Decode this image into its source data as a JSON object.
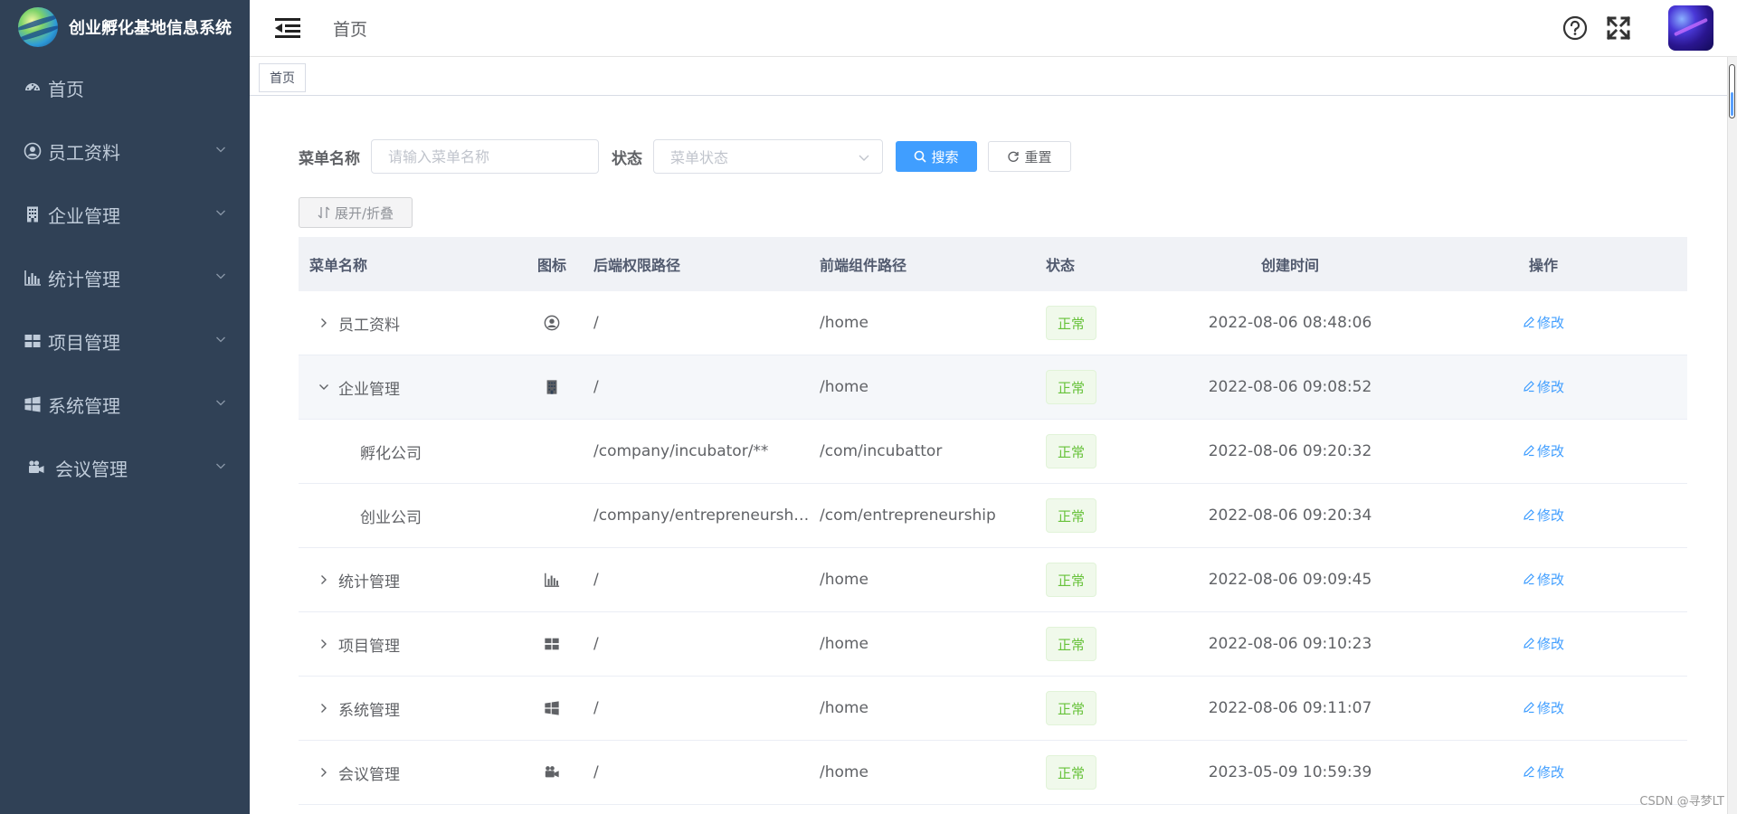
{
  "app": {
    "title": "创业孵化基地信息系统"
  },
  "sidebar": {
    "items": [
      {
        "label": "首页",
        "icon": "dashboard-icon",
        "expandable": false
      },
      {
        "label": "员工资料",
        "icon": "user-circle-icon",
        "expandable": true
      },
      {
        "label": "企业管理",
        "icon": "building-icon",
        "expandable": true
      },
      {
        "label": "统计管理",
        "icon": "bar-chart-icon",
        "expandable": true
      },
      {
        "label": "项目管理",
        "icon": "grid-icon",
        "expandable": true
      },
      {
        "label": "系统管理",
        "icon": "windows-icon",
        "expandable": true
      },
      {
        "label": "会议管理",
        "icon": "camera-icon",
        "expandable": true
      }
    ]
  },
  "header": {
    "breadcrumb": "首页"
  },
  "tags": {
    "active": "首页"
  },
  "search": {
    "menu_name_label": "菜单名称",
    "menu_name_placeholder": "请输入菜单名称",
    "status_label": "状态",
    "status_placeholder": "菜单状态",
    "search_button": "搜索",
    "reset_button": "重置",
    "toggle_button": "展开/折叠"
  },
  "table": {
    "headers": {
      "name": "菜单名称",
      "icon": "图标",
      "perm": "后端权限路径",
      "component": "前端组件路径",
      "status": "状态",
      "created": "创建时间",
      "ops": "操作"
    },
    "rows": [
      {
        "name": "员工资料",
        "icon": "user-circle-icon",
        "perm": "/",
        "component": "/home",
        "status": "正常",
        "created": "2022-08-06 08:48:06",
        "op": "修改",
        "level": 0,
        "expand": "collapsed"
      },
      {
        "name": "企业管理",
        "icon": "building-icon",
        "perm": "/",
        "component": "/home",
        "status": "正常",
        "created": "2022-08-06 09:08:52",
        "op": "修改",
        "level": 0,
        "expand": "expanded"
      },
      {
        "name": "孵化公司",
        "icon": "",
        "perm": "/company/incubator/**",
        "component": "/com/incubattor",
        "status": "正常",
        "created": "2022-08-06 09:20:32",
        "op": "修改",
        "level": 1,
        "expand": "none"
      },
      {
        "name": "创业公司",
        "icon": "",
        "perm": "/company/entrepreneurshi…",
        "component": "/com/entrepreneurship",
        "status": "正常",
        "created": "2022-08-06 09:20:34",
        "op": "修改",
        "level": 1,
        "expand": "none"
      },
      {
        "name": "统计管理",
        "icon": "bar-chart-icon",
        "perm": "/",
        "component": "/home",
        "status": "正常",
        "created": "2022-08-06 09:09:45",
        "op": "修改",
        "level": 0,
        "expand": "collapsed"
      },
      {
        "name": "项目管理",
        "icon": "grid-icon",
        "perm": "/",
        "component": "/home",
        "status": "正常",
        "created": "2022-08-06 09:10:23",
        "op": "修改",
        "level": 0,
        "expand": "collapsed"
      },
      {
        "name": "系统管理",
        "icon": "windows-icon",
        "perm": "/",
        "component": "/home",
        "status": "正常",
        "created": "2022-08-06 09:11:07",
        "op": "修改",
        "level": 0,
        "expand": "collapsed"
      },
      {
        "name": "会议管理",
        "icon": "camera-icon",
        "perm": "/",
        "component": "/home",
        "status": "正常",
        "created": "2023-05-09 10:59:39",
        "op": "修改",
        "level": 0,
        "expand": "collapsed"
      }
    ]
  },
  "watermark": "CSDN @寻梦LT",
  "colors": {
    "sidebar_bg": "#304156",
    "primary": "#409eff",
    "success": "#67c23a"
  }
}
